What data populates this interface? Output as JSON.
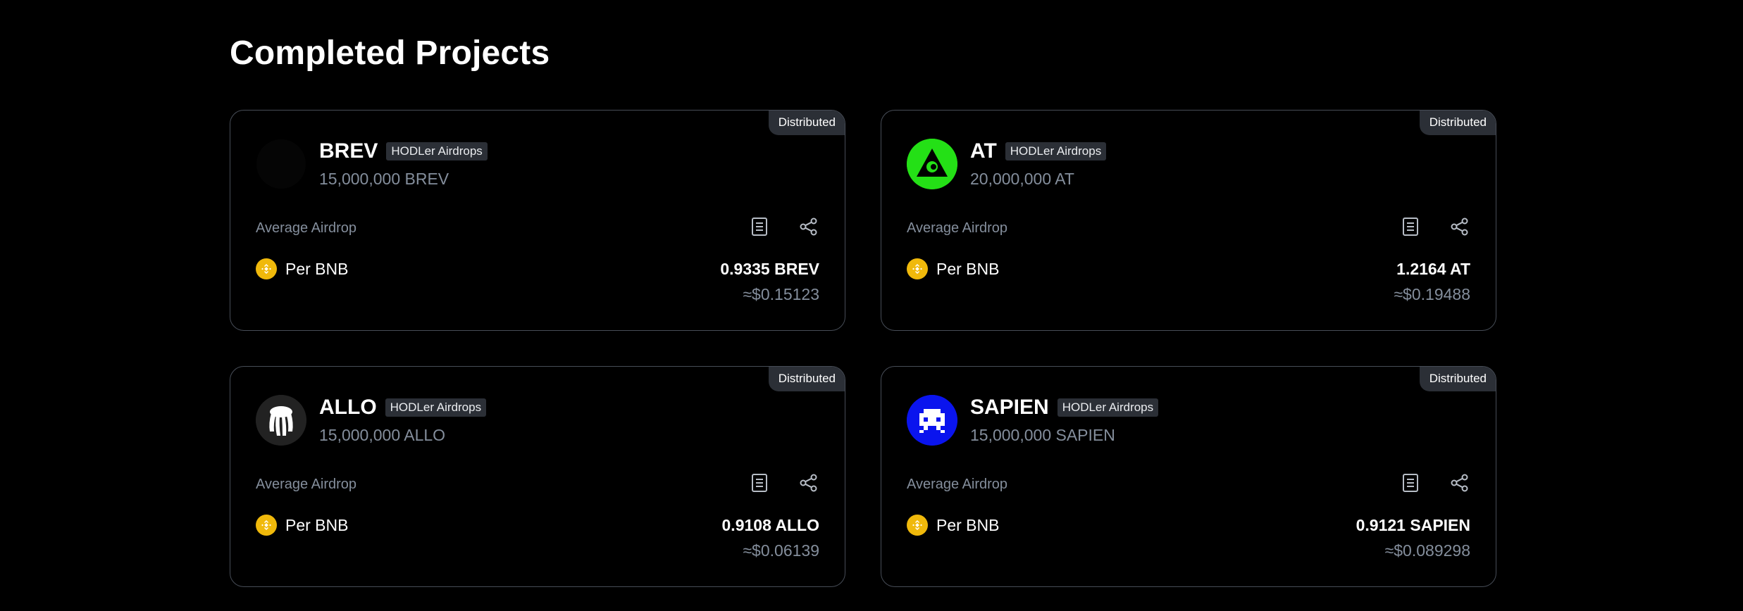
{
  "page": {
    "title": "Completed Projects"
  },
  "colors": {
    "background": "#000000",
    "card_border": "#474d57",
    "badge_bg": "#2b2f36",
    "muted_text": "#848e9c",
    "bnb_yellow": "#f0b90b"
  },
  "labels": {
    "avg_airdrop": "Average Airdrop",
    "per_bnb": "Per BNB"
  },
  "cards": [
    {
      "status": "Distributed",
      "name": "BREV",
      "tag": "HODLer Airdrops",
      "supply": "15,000,000 BREV",
      "logo_icon": "brev-logo-icon",
      "logo_color": "#000000",
      "avg_value": "0.9335 BREV",
      "usd_value": "≈$0.15123"
    },
    {
      "status": "Distributed",
      "name": "AT",
      "tag": "HODLer Airdrops",
      "supply": "20,000,000 AT",
      "logo_icon": "at-logo-icon",
      "logo_color": "#24e016",
      "avg_value": "1.2164 AT",
      "usd_value": "≈$0.19488"
    },
    {
      "status": "Distributed",
      "name": "ALLO",
      "tag": "HODLer Airdrops",
      "supply": "15,000,000 ALLO",
      "logo_icon": "allo-logo-icon",
      "logo_color": "#222222",
      "avg_value": "0.9108 ALLO",
      "usd_value": "≈$0.06139"
    },
    {
      "status": "Distributed",
      "name": "SAPIEN",
      "tag": "HODLer Airdrops",
      "supply": "15,000,000 SAPIEN",
      "logo_icon": "sapien-logo-icon",
      "logo_color": "#0a14ee",
      "avg_value": "0.9121 SAPIEN",
      "usd_value": "≈$0.089298"
    }
  ]
}
